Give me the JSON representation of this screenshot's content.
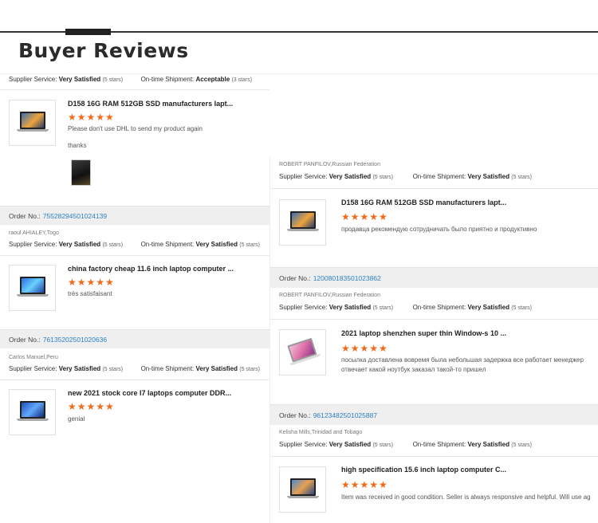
{
  "heading": "Buyer Reviews",
  "labels": {
    "supplier_service": "Supplier Service:",
    "ontime_shipment": "On-time Shipment:",
    "order_no": "Order No.:"
  },
  "left": {
    "top_meta": {
      "supplier": "Very Satisfied",
      "supplier_stars": "(5 stars)",
      "shipment": "Acceptable",
      "shipment_stars": "(3 stars)"
    },
    "review1": {
      "title": "D158 16G RAM 512GB SSD manufacturers lapt...",
      "stars": "★★★★★",
      "text": "Please don't use DHL to send my product again",
      "text2": "thanks"
    },
    "order2": {
      "number": "75528294501024139",
      "buyer": "raoul AHIALEY,Togo",
      "supplier": "Very Satisfied",
      "supplier_stars": "(5 stars)",
      "shipment": "Very Satisfied",
      "shipment_stars": "(5 stars)"
    },
    "review2": {
      "title": "china factory cheap 11.6 inch laptop computer ...",
      "stars": "★★★★★",
      "text": "très satisfaisant"
    },
    "order3": {
      "number": "76135202501020636",
      "buyer": "Carlos Manuel,Peru",
      "supplier": "Very Satisfied",
      "supplier_stars": "(5 stars)",
      "shipment": "Very Satisfied",
      "shipment_stars": "(5 stars)"
    },
    "review3": {
      "title": "new 2021 stock core I7 laptops computer DDR...",
      "stars": "★★★★★",
      "text": "genial"
    }
  },
  "right": {
    "meta1": {
      "buyer": "ROBERT PANFILOV,Russian Federation",
      "supplier": "Very Satisfied",
      "supplier_stars": "(5 stars)",
      "shipment": "Very Satisfied",
      "shipment_stars": "(5 stars)"
    },
    "review1": {
      "title": "D158 16G RAM 512GB SSD manufacturers lapt...",
      "stars": "★★★★★",
      "text": "продавца рекомендую сотрудничать  было приятно  и продуктивно"
    },
    "order2": {
      "number": "120080183501023862",
      "buyer": "ROBERT PANFILOV,Russian Federation",
      "supplier": "Very Satisfied",
      "supplier_stars": "(5 stars)",
      "shipment": "Very Satisfied",
      "shipment_stars": "(5 stars)"
    },
    "review2": {
      "title": "2021 laptop shenzhen super thin Window-s 10 ...",
      "stars": "★★★★★",
      "text": "посылка доставлена  вовремя  была  небольшая  задержка все работает менеджер",
      "text2": "отвечает какой ноутбук  заказал такой-то пришел"
    },
    "order3": {
      "number": "96123482501025887",
      "buyer": "Kelisha Mills,Trinidad and Tobago",
      "supplier": "Very Satisfied",
      "supplier_stars": "(5 stars)",
      "shipment": "Very Satisfied",
      "shipment_stars": "(5 stars)"
    },
    "review3": {
      "title": "high specification 15.6 inch laptop computer C...",
      "stars": "★★★★★",
      "text": "Item was received in good condition. Seller is always responsive and helpful. Will use ag"
    }
  },
  "colors": {
    "star": "#f06a18",
    "order_link": "#2f80c4",
    "order_bar": "#efefef"
  }
}
